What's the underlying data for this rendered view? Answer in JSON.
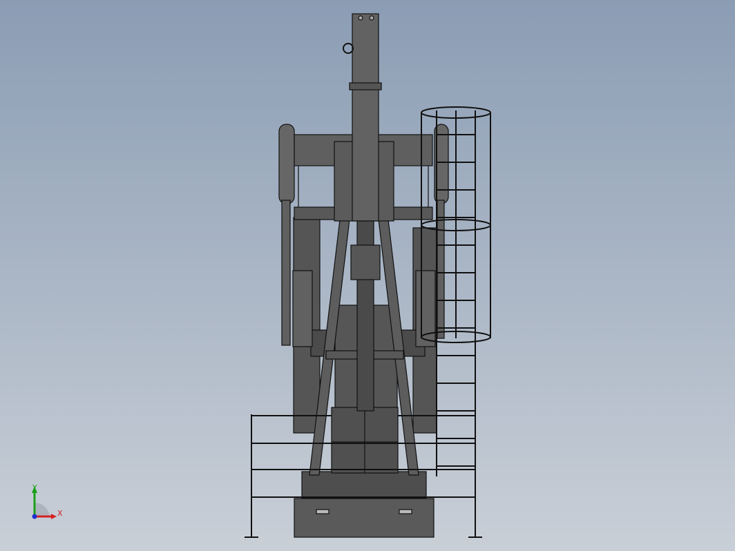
{
  "view": {
    "background_top": "#8b9db4",
    "background_bottom": "#c9cfd7",
    "model_fill": "#5c5c5c",
    "model_fill_dark": "#4b4b4b",
    "model_edge": "#101010"
  },
  "triad": {
    "x_label": "X",
    "y_label": "Y",
    "x_color": "#d42020",
    "y_color": "#1aa01a",
    "z_color": "#1f2fd0"
  }
}
